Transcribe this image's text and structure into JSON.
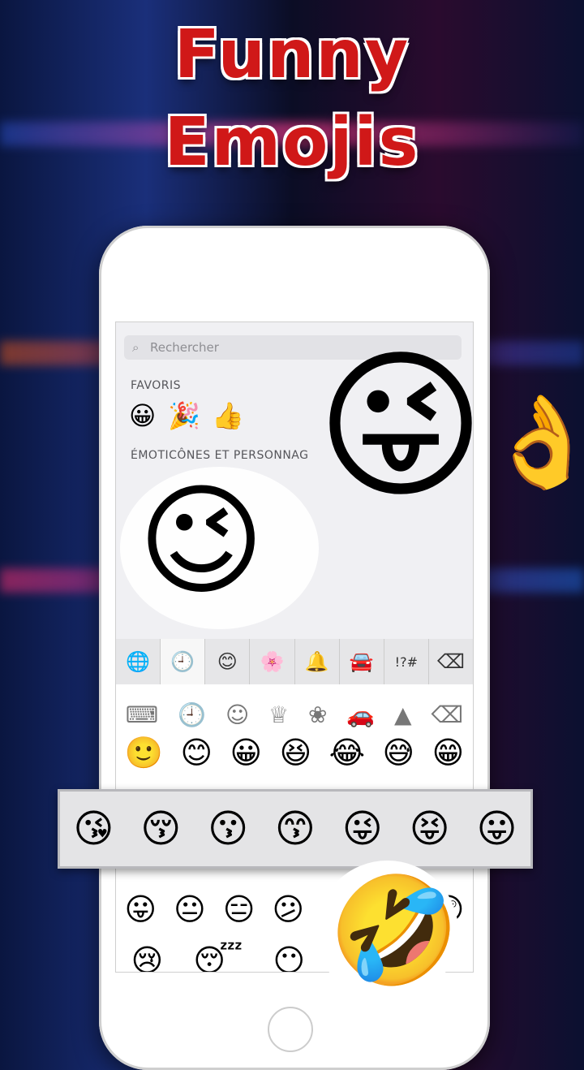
{
  "title_line1": "Funny",
  "title_line2": "Emojis",
  "search": {
    "placeholder": "Rechercher"
  },
  "sections": {
    "favorites": "FAVORIS",
    "emoticons": "ÉMOTICÔNES ET PERSONNAG"
  },
  "favorites": [
    "😀",
    "🎉",
    "👍"
  ],
  "tabs": [
    "🌐",
    "🕘",
    "😊",
    "🌸",
    "🔔",
    "🚘",
    "!?#",
    "⌫"
  ],
  "kb2_bar": [
    "⌨",
    "🕘",
    "☺",
    "♕",
    "❀",
    "🚗",
    "▲",
    "⌫"
  ],
  "kb2_rows": [
    [
      "🙂",
      "😊",
      "😀",
      "😆",
      "😂",
      "😅",
      "😁"
    ],
    [
      "😛",
      "😐",
      "😑",
      "😕",
      "🤣",
      "🙁",
      "😲"
    ],
    [
      "😢",
      "😴",
      "😶",
      "😝",
      "",
      "",
      ""
    ]
  ],
  "strip": [
    "😘",
    "😚",
    "😗",
    "😙",
    "😜",
    "😝",
    "😛"
  ]
}
